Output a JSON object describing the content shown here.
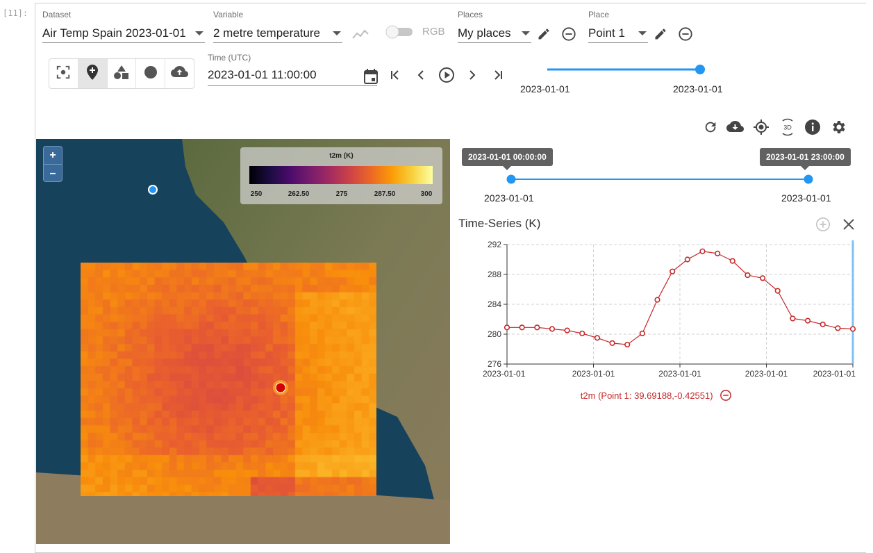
{
  "cell_prompt": "[11]:",
  "dataset": {
    "label": "Dataset",
    "value": "Air Temp Spain 2023-01-01"
  },
  "variable": {
    "label": "Variable",
    "value": "2 metre temperature"
  },
  "rgb_toggle": {
    "label": "RGB",
    "on": false
  },
  "places": {
    "label": "Places",
    "value": "My places"
  },
  "place": {
    "label": "Place",
    "value": "Point 1"
  },
  "tools": [
    {
      "icon": "select-area-icon",
      "active": false
    },
    {
      "icon": "add-point-icon",
      "active": true
    },
    {
      "icon": "add-polygon-icon",
      "active": false
    },
    {
      "icon": "add-circle-icon",
      "active": false
    },
    {
      "icon": "upload-cloud-icon",
      "active": false
    }
  ],
  "time": {
    "label": "Time (UTC)",
    "value": "2023-01-01 11:00:00"
  },
  "time_slider": {
    "start_label": "2023-01-01",
    "end_label": "2023-01-01",
    "position": 1.0
  },
  "panel_actions": [
    "refresh-icon",
    "download-icon",
    "locate-icon",
    "3d-view-icon",
    "info-icon",
    "settings-icon"
  ],
  "range_slider": {
    "start_tooltip": "2023-01-01 00:00:00",
    "end_tooltip": "2023-01-01 23:00:00",
    "start_label": "2023-01-01",
    "end_label": "2023-01-01"
  },
  "map_legend": {
    "title": "t2m (K)",
    "ticks": [
      "250",
      "262.50",
      "275",
      "287.50",
      "300"
    ]
  },
  "zoom": {
    "in": "+",
    "out": "–"
  },
  "timeseries": {
    "title": "Time-Series (K)",
    "legend": "t2m (Point 1: 39.69188,-0.42551)"
  },
  "chart_data": {
    "type": "line",
    "x": [
      0,
      1,
      2,
      3,
      4,
      5,
      6,
      7,
      8,
      9,
      10,
      11,
      12,
      13,
      14,
      15,
      16,
      17,
      18,
      19,
      20,
      21,
      22,
      23
    ],
    "series": [
      {
        "name": "t2m (Point 1: 39.69188,-0.42551)",
        "values": [
          280.9,
          280.9,
          280.9,
          280.7,
          280.5,
          280.1,
          279.5,
          278.8,
          278.6,
          280.1,
          284.6,
          288.4,
          290.0,
          291.1,
          290.8,
          289.8,
          287.9,
          287.5,
          285.8,
          282.1,
          281.8,
          281.3,
          280.8,
          280.7
        ]
      }
    ],
    "xlabel": "",
    "ylabel": "",
    "ylim": [
      276,
      292
    ],
    "yticks": [
      "292",
      "288",
      "284",
      "280",
      "276"
    ],
    "xtick_labels": [
      "2023-01-01",
      "2023-01-01",
      "2023-01-01",
      "2023-01-01",
      "2023-01-01"
    ],
    "line_color": "#c62828",
    "grid": true
  },
  "colors": {
    "accent": "#2196f3",
    "series": "#c62828",
    "tooltip": "#616161"
  }
}
